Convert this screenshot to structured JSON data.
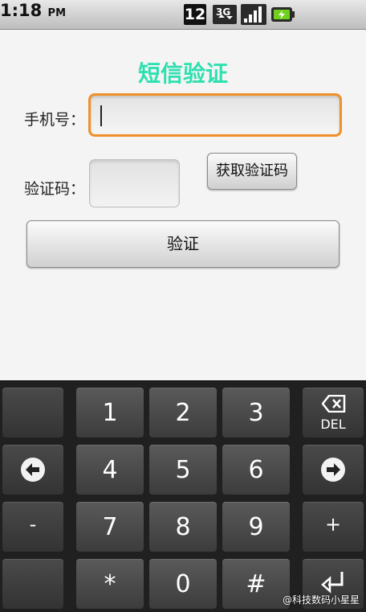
{
  "status_bar": {
    "notification_count": "12",
    "network_type": "3G",
    "time": "1:18",
    "ampm": "PM"
  },
  "form": {
    "title": "短信验证",
    "phone_label": "手机号：",
    "phone_value": "",
    "code_label": "验证码：",
    "code_value": "",
    "get_code_button": "获取验证码",
    "verify_button": "验证"
  },
  "keyboard": {
    "keys": {
      "one": "1",
      "two": "2",
      "three": "3",
      "four": "4",
      "five": "5",
      "six": "6",
      "seven": "7",
      "eight": "8",
      "nine": "9",
      "star": "*",
      "zero": "0",
      "hash": "#",
      "minus": "-",
      "plus": "+",
      "del": "DEL"
    }
  },
  "watermark": "@科技数码小星星",
  "colors": {
    "title": "#2ee0b0",
    "focus_border": "#f0902a"
  }
}
